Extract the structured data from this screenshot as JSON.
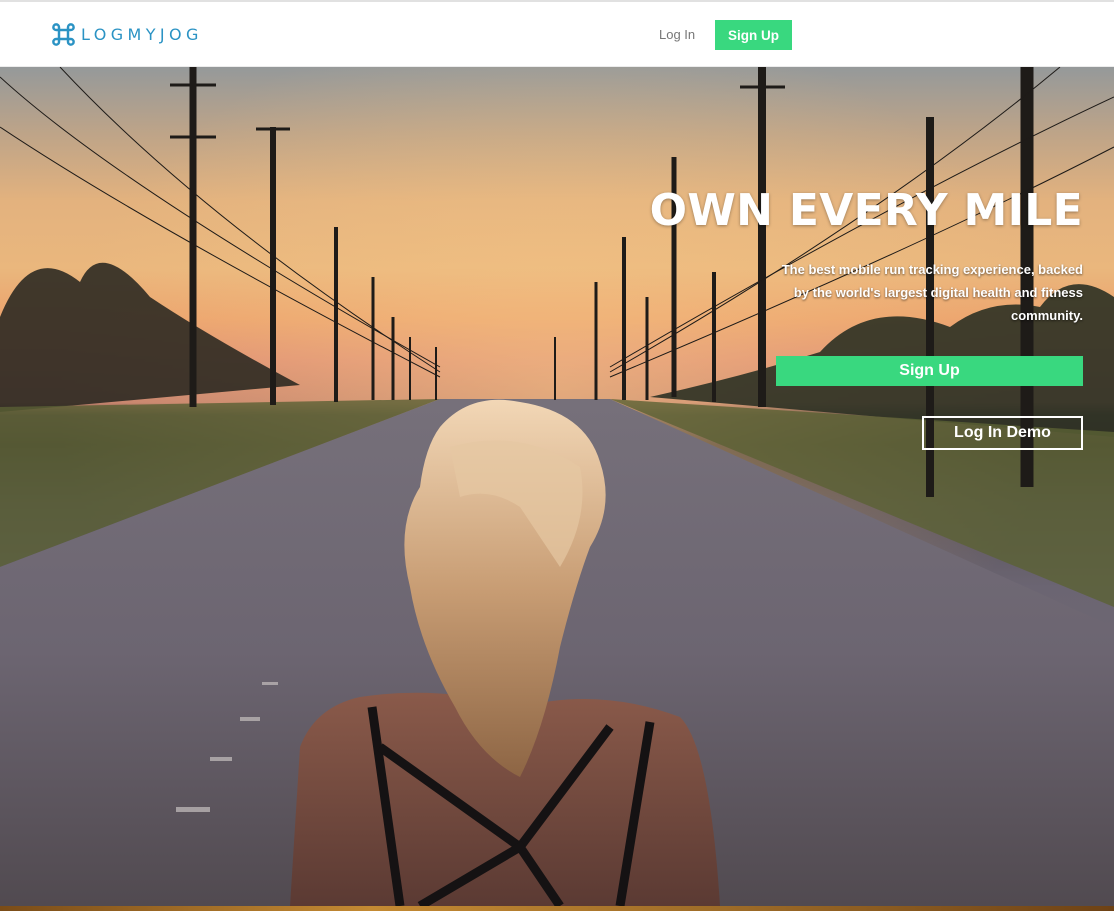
{
  "header": {
    "logo_text": "LOGMYJOG",
    "logo_icon": "command-key-icon",
    "login_label": "Log In",
    "signup_label": "Sign Up"
  },
  "hero": {
    "title": "OWN EVERY MILE",
    "subtitle": "The best mobile run tracking experience, backed by the world's largest digital health and fitness community.",
    "signup_label": "Sign Up",
    "demo_label": "Log In Demo",
    "background": "photo of a runner with a blonde ponytail standing on a country road at sunset, power lines on both sides"
  },
  "colors": {
    "brand": "#2b93c4",
    "accent_green": "#39d87f",
    "nav_link": "#777777",
    "hero_text": "#ffffff"
  }
}
